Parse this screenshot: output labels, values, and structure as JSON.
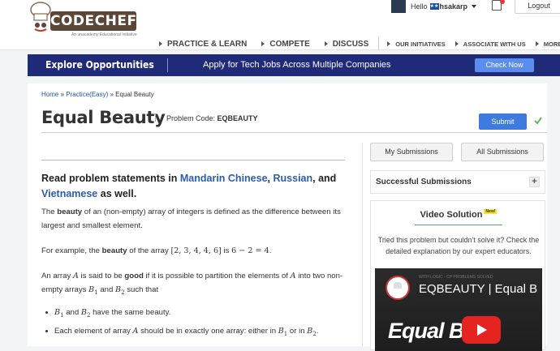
{
  "header": {
    "logo_text": "CODECHEF",
    "logo_sub": "An unacademy Educational Initiative",
    "greeting": "Hello",
    "username": "hsakarp",
    "logout": "Logout"
  },
  "nav": {
    "practice": "PRACTICE & LEARN",
    "compete": "COMPETE",
    "discuss": "DISCUSS",
    "initiatives": "OUR INITIATIVES",
    "associate": "ASSOCIATE WITH US",
    "more": "MORE"
  },
  "banner": {
    "explore": "Explore Opportunities",
    "message": "Apply for Tech Jobs Across Multiple Companies",
    "cta": "Check Now"
  },
  "breadcrumb": {
    "home": "Home",
    "sep1": " » ",
    "practice": "Practice(Easy)",
    "sep2": " » ",
    "current": "Equal Beauty"
  },
  "problem": {
    "title": "Equal Beauty",
    "code_label": "Problem Code:",
    "code": "EQBEAUTY",
    "submit": "Submit"
  },
  "statement": {
    "lang_prefix": "Read problem statements in ",
    "lang_mandarin": "Mandarin Chinese",
    "comma": ", ",
    "lang_russian": "Russian",
    "and": ", and",
    "lang_vietnamese": "Vietnamese",
    "lang_suffix": " as well.",
    "p1_a": "The ",
    "p1_bold": "beauty",
    "p1_b": " of an (non-empty) array of integers is defined as the difference between its largest and smallest element.",
    "p2_a": "For example, the ",
    "p2_bold": "beauty",
    "p2_b": " of the array ",
    "p2_array": "[2, 3, 4, 4, 6]",
    "p2_c": " is ",
    "p2_expr": "6 − 2 = 4",
    "p2_d": ".",
    "p3_a": "An array ",
    "p3_A": "A",
    "p3_b": " is said to be ",
    "p3_bold": "good",
    "p3_c": " if it is possible to partition the elements of ",
    "p3_A2": "A",
    "p3_d": " into two non-empty arrays ",
    "p3_B": "B",
    "p3_sub1": "1",
    "p3_e": " and ",
    "p3_B2": "B",
    "p3_sub2": "2",
    "p3_f": " such that",
    "b1_B": "B",
    "b1_sub1": "1",
    "b1_and": " and ",
    "b1_B2": "B",
    "b1_sub2": "2",
    "b1_rest": " have the same beauty.",
    "b2_a": "Each element of array ",
    "b2_A": "A",
    "b2_b": " should be in exactly one array: either in ",
    "b2_B": "B",
    "b2_sub1": "1",
    "b2_or": " or in ",
    "b2_B2": "B",
    "b2_sub2": "2",
    "b2_end": "."
  },
  "sidebar": {
    "my_submissions": "My Submissions",
    "all_submissions": "All Submissions",
    "successful": "Successful Submissions",
    "plus": "+",
    "video_title": "Video Solution",
    "video_new": "New!",
    "video_desc": "Tried this problem but couldn't solve it? Check the detailed explanation by our expert educators.",
    "thumb_small": "WITH LOGIC - CP PROBLEMS SOLVED",
    "thumb_title": "EQBEAUTY | Equal B",
    "thumb_big": "Equal Be"
  }
}
